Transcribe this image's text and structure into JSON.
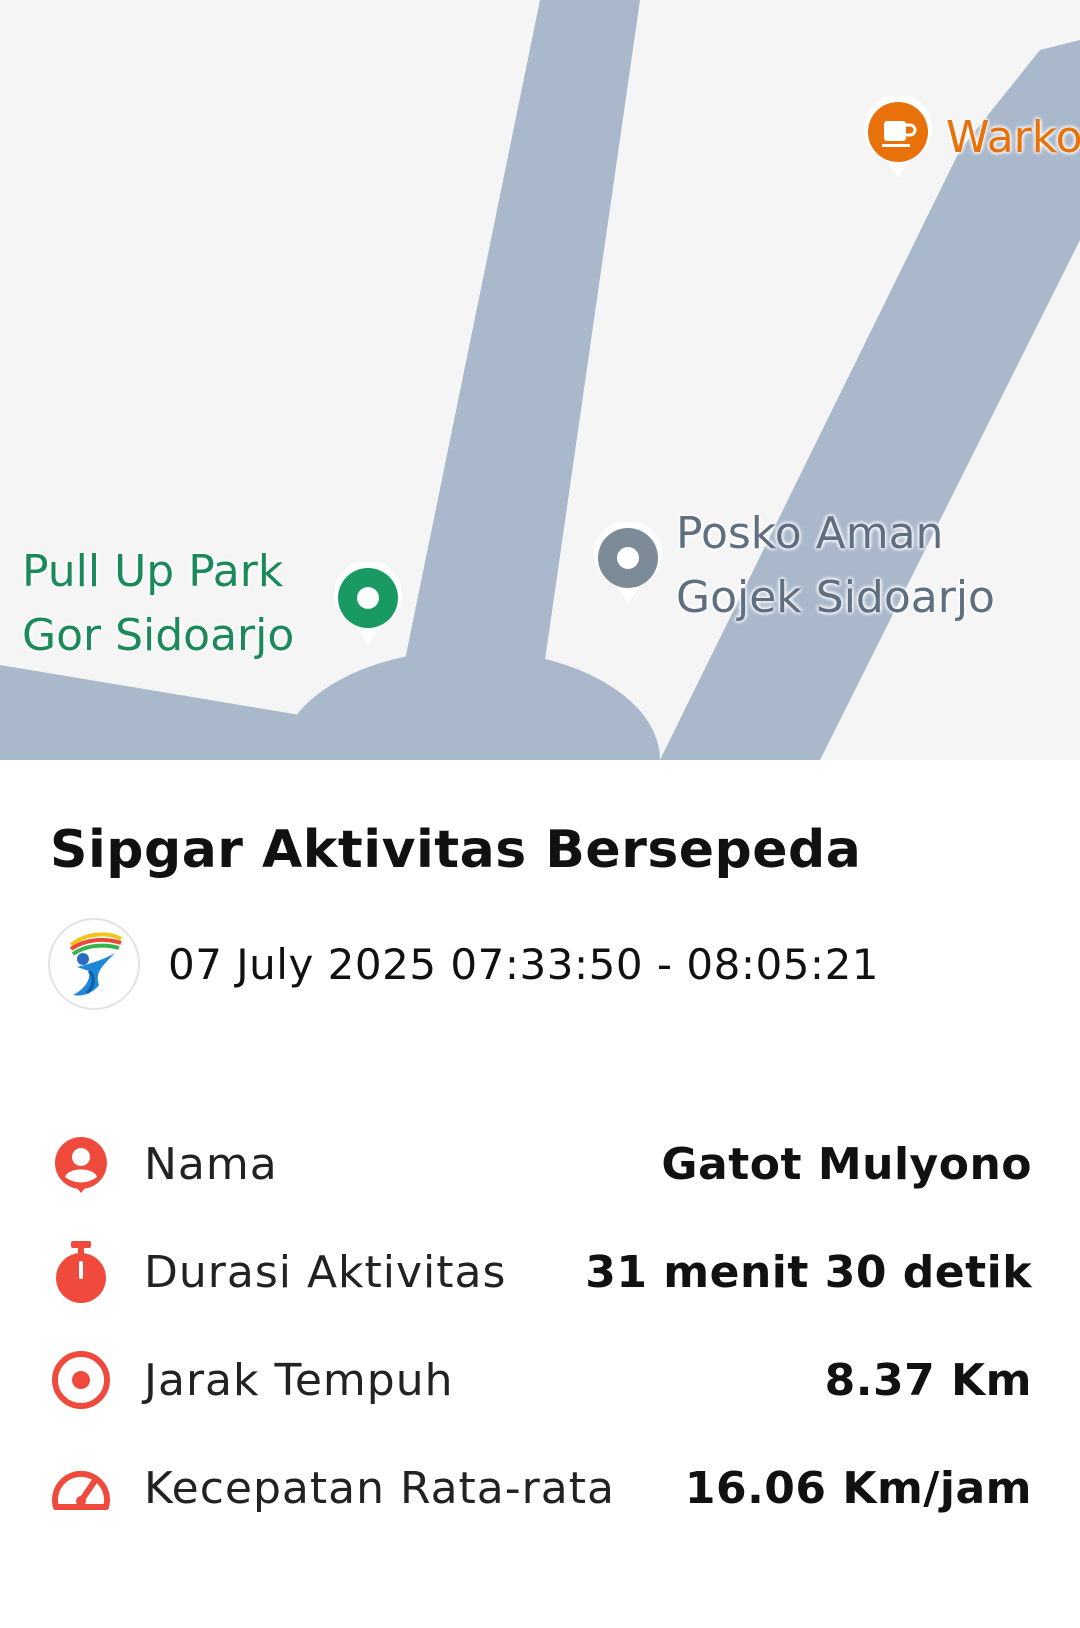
{
  "map": {
    "pois": [
      {
        "name": "Warko",
        "color": "#e8710a",
        "icon": "cafe-icon"
      },
      {
        "name": "Pull Up Park\nGor Sidoarjo",
        "color": "#1a8a5a",
        "icon": "park-pin-icon"
      },
      {
        "name": "Posko Aman\nGojek Sidoarjo",
        "color": "#5f6f80",
        "icon": "place-pin-icon"
      }
    ],
    "colors": {
      "background": "#f5f5f5",
      "road": "#a9b8cb"
    }
  },
  "activity": {
    "title": "Sipgar Aktivitas Bersepeda",
    "datetime": "07 July 2025 07:33:50 - 08:05:21",
    "logo_icon": "sipgar-logo-icon"
  },
  "stats": [
    {
      "icon": "person-icon",
      "label": "Nama",
      "value": "Gatot Mulyono"
    },
    {
      "icon": "stopwatch-icon",
      "label": "Durasi Aktivitas",
      "value": "31 menit 30 detik"
    },
    {
      "icon": "target-icon",
      "label": "Jarak Tempuh",
      "value": "8.37 Km"
    },
    {
      "icon": "speedometer-icon",
      "label": "Kecepatan Rata-rata",
      "value": "16.06 Km/jam"
    }
  ],
  "accent_color": "#ef4a3c"
}
